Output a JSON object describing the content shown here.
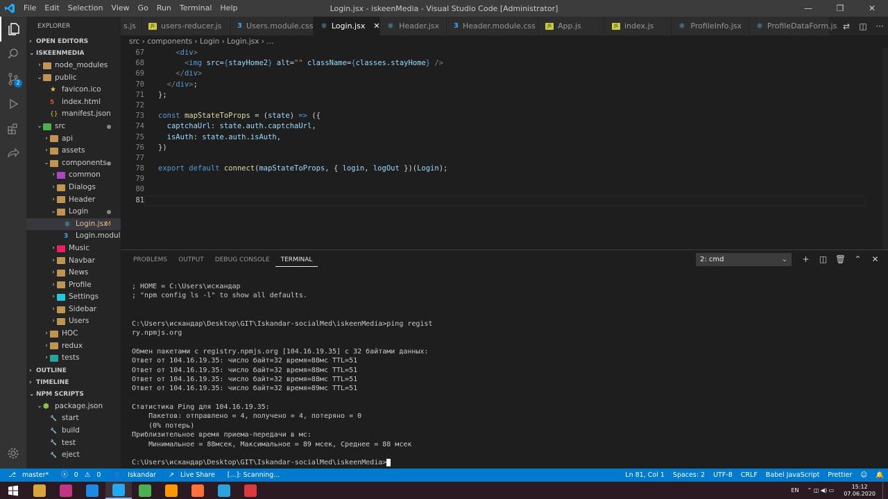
{
  "window": {
    "title": "Login.jsx - iskeenMedia - Visual Studio Code [Administrator]",
    "menu": [
      "File",
      "Edit",
      "Selection",
      "View",
      "Go",
      "Run",
      "Terminal",
      "Help"
    ]
  },
  "explorer": {
    "title": "EXPLORER",
    "open_editors": "OPEN EDITORS",
    "project": "ISKEENMEDIA",
    "outline": "OUTLINE",
    "timeline": "TIMELINE",
    "npm_scripts": "NPM SCRIPTS"
  },
  "tree": [
    {
      "label": "node_modules",
      "depth": 1,
      "chevron": "›",
      "icon": "folder"
    },
    {
      "label": "public",
      "depth": 1,
      "chevron": "⌄",
      "icon": "folder"
    },
    {
      "label": "favicon.ico",
      "depth": 2,
      "chevron": "",
      "icon": "star"
    },
    {
      "label": "index.html",
      "depth": 2,
      "chevron": "",
      "icon": "html"
    },
    {
      "label": "manifest.json",
      "depth": 2,
      "chevron": "",
      "icon": "json"
    },
    {
      "label": "src",
      "depth": 1,
      "chevron": "⌄",
      "icon": "src",
      "dot": true
    },
    {
      "label": "api",
      "depth": 2,
      "chevron": "›",
      "icon": "folder"
    },
    {
      "label": "assets",
      "depth": 2,
      "chevron": "›",
      "icon": "folder"
    },
    {
      "label": "components",
      "depth": 2,
      "chevron": "⌄",
      "icon": "folder",
      "dot": true
    },
    {
      "label": "common",
      "depth": 3,
      "chevron": "›",
      "icon": "folder"
    },
    {
      "label": "Dialogs",
      "depth": 3,
      "chevron": "›",
      "icon": "folder"
    },
    {
      "label": "Header",
      "depth": 3,
      "chevron": "›",
      "icon": "folder"
    },
    {
      "label": "Login",
      "depth": 3,
      "chevron": "⌄",
      "icon": "folder",
      "dot": true
    },
    {
      "label": "Login.jsx",
      "depth": 4,
      "chevron": "",
      "icon": "react",
      "mark": "M",
      "selected": true
    },
    {
      "label": "Login.module...",
      "depth": 4,
      "chevron": "",
      "icon": "css"
    },
    {
      "label": "Music",
      "depth": 3,
      "chevron": "›",
      "icon": "folder"
    },
    {
      "label": "Navbar",
      "depth": 3,
      "chevron": "›",
      "icon": "folder"
    },
    {
      "label": "News",
      "depth": 3,
      "chevron": "›",
      "icon": "folder"
    },
    {
      "label": "Profile",
      "depth": 3,
      "chevron": "›",
      "icon": "folder"
    },
    {
      "label": "Settings",
      "depth": 3,
      "chevron": "›",
      "icon": "folder"
    },
    {
      "label": "Sidebar",
      "depth": 3,
      "chevron": "›",
      "icon": "folder"
    },
    {
      "label": "Users",
      "depth": 3,
      "chevron": "›",
      "icon": "folder"
    },
    {
      "label": "HOC",
      "depth": 2,
      "chevron": "›",
      "icon": "folder"
    },
    {
      "label": "redux",
      "depth": 2,
      "chevron": "›",
      "icon": "folder"
    },
    {
      "label": "tests",
      "depth": 2,
      "chevron": "›",
      "icon": "folder"
    }
  ],
  "npm": [
    {
      "label": "package.json",
      "depth": 1,
      "chevron": "⌄",
      "icon": "pkg"
    },
    {
      "label": "start",
      "depth": 2,
      "icon": "wrench"
    },
    {
      "label": "build",
      "depth": 2,
      "icon": "wrench"
    },
    {
      "label": "test",
      "depth": 2,
      "icon": "wrench"
    },
    {
      "label": "eject",
      "depth": 2,
      "icon": "wrench"
    }
  ],
  "tabs": [
    {
      "label": "s.js",
      "icon": "js"
    },
    {
      "label": "users-reducer.js",
      "icon": "js"
    },
    {
      "label": "Users.module.css",
      "icon": "css"
    },
    {
      "label": "Login.jsx",
      "icon": "react",
      "active": true,
      "close": "✕"
    },
    {
      "label": "Header.jsx",
      "icon": "react"
    },
    {
      "label": "Header.module.css",
      "icon": "css"
    },
    {
      "label": "App.js",
      "icon": "js"
    },
    {
      "label": "index.js",
      "icon": "js"
    },
    {
      "label": "ProfileInfo.jsx",
      "icon": "react"
    },
    {
      "label": "ProfileDataForm.js",
      "icon": "react"
    }
  ],
  "breadcrumb": "src › components › Login › Login.jsx › ...",
  "code": [
    {
      "n": "67",
      "html": "    <span class='p'>&lt;</span><span class='tg'>div</span><span class='p'>&gt;</span>"
    },
    {
      "n": "68",
      "html": "      <span class='p'>&lt;</span><span class='tg'>img</span> <span class='at'>src</span><span class='t'>=</span><span class='k'>{</span><span class='v'>stayHome2</span><span class='k'>}</span> <span class='at'>alt</span><span class='t'>=</span><span class='s'>\"\"</span> <span class='at'>className</span><span class='t'>=</span><span class='k'>{</span><span class='v'>classes</span><span class='t'>.</span><span class='v'>stayHome</span><span class='k'>}</span> <span class='p'>/&gt;</span>"
    },
    {
      "n": "69",
      "html": "    <span class='p'>&lt;/</span><span class='tg'>div</span><span class='p'>&gt;</span>"
    },
    {
      "n": "70",
      "html": "  <span class='p'>&lt;/</span><span class='tg'>div</span><span class='p'>&gt;</span><span class='t'>;</span>"
    },
    {
      "n": "71",
      "html": "<span class='t'>};</span>"
    },
    {
      "n": "72",
      "html": ""
    },
    {
      "n": "73",
      "html": "<span class='k'>const</span> <span class='f'>mapStateToProps</span> <span class='t'>=</span> <span class='t'>(</span><span class='v'>state</span><span class='t'>)</span> <span class='k'>=&gt;</span> <span class='t'>({</span>"
    },
    {
      "n": "74",
      "html": "  <span class='v'>captchaUrl</span><span class='t'>:</span> <span class='v'>state</span><span class='t'>.</span><span class='v'>auth</span><span class='t'>.</span><span class='v'>captchaUrl</span><span class='t'>,</span>"
    },
    {
      "n": "75",
      "html": "  <span class='v'>isAuth</span><span class='t'>:</span> <span class='v'>state</span><span class='t'>.</span><span class='v'>auth</span><span class='t'>.</span><span class='v'>isAuth</span><span class='t'>,</span>"
    },
    {
      "n": "76",
      "html": "<span class='t'>})</span>"
    },
    {
      "n": "77",
      "html": ""
    },
    {
      "n": "78",
      "html": "<span class='k'>export</span> <span class='k'>default</span> <span class='f'>connect</span><span class='t'>(</span><span class='v'>mapStateToProps</span><span class='t'>,</span> <span class='t'>{</span> <span class='v'>login</span><span class='t'>,</span> <span class='v'>logOut</span> <span class='t'>})(</span><span class='v'>Login</span><span class='t'>);</span>"
    },
    {
      "n": "79",
      "html": ""
    },
    {
      "n": "80",
      "html": ""
    },
    {
      "n": "81",
      "html": "",
      "cur": true
    }
  ],
  "panel": {
    "tabs": [
      "PROBLEMS",
      "OUTPUT",
      "DEBUG CONSOLE",
      "TERMINAL"
    ],
    "active": "TERMINAL",
    "terminal_select": "2: cmd"
  },
  "terminal": [
    "; HOME = C:\\Users\\искандар",
    "; \"npm config ls -l\" to show all defaults.",
    "",
    "",
    "C:\\Users\\искандар\\Desktop\\GIT\\Iskandar-socialMed\\iskeenMedia>ping regist",
    "ry.npmjs.org",
    "",
    "Обмен пакетами с registry.npmjs.org [104.16.19.35] с 32 байтами данных:",
    "Ответ от 104.16.19.35: число байт=32 время=88мс TTL=51",
    "Ответ от 104.16.19.35: число байт=32 время=88мс TTL=51",
    "Ответ от 104.16.19.35: число байт=32 время=88мс TTL=51",
    "Ответ от 104.16.19.35: число байт=32 время=89мс TTL=51",
    "",
    "Статистика Ping для 104.16.19.35:",
    "    Пакетов: отправлено = 4, получено = 4, потеряно = 0",
    "    (0% потерь)",
    "Приблизительное время приема-передачи в мс:",
    "    Минимальное = 88мсек, Максимальное = 89 мсек, Среднее = 88 мсек",
    ""
  ],
  "terminal_prompt": "C:\\Users\\искандар\\Desktop\\GIT\\Iskandar-socialMed\\iskeenMedia>",
  "status": {
    "branch": "master*",
    "errors": "0",
    "warnings": "0",
    "user": "Iskandar",
    "live_share": "Live Share",
    "scanning": "[...]: Scanning...",
    "position": "Ln 81, Col 1",
    "spaces": "Spaces: 2",
    "encoding": "UTF-8",
    "eol": "CRLF",
    "language": "Babel JavaScript",
    "formatter": "Prettier"
  },
  "taskbar": {
    "lang": "EN",
    "time": "15:12",
    "date": "07.06.2020",
    "apps": [
      {
        "name": "file-explorer",
        "color": "#d9a53a"
      },
      {
        "name": "instagram",
        "color": "#c13584"
      },
      {
        "name": "app-blue",
        "color": "#1e88e5"
      },
      {
        "name": "vscode",
        "color": "#23a9f2",
        "active": true
      },
      {
        "name": "chrome",
        "color": "#4caf50"
      },
      {
        "name": "sublime",
        "color": "#ff9800"
      },
      {
        "name": "firefox",
        "color": "#ff7139"
      },
      {
        "name": "telegram",
        "color": "#2aa3df"
      },
      {
        "name": "expressvpn",
        "color": "#da3940"
      }
    ]
  },
  "colors": {
    "accent": "#007acc",
    "activity": "#333333",
    "sidebar": "#252526",
    "editor": "#1e1e1e"
  }
}
